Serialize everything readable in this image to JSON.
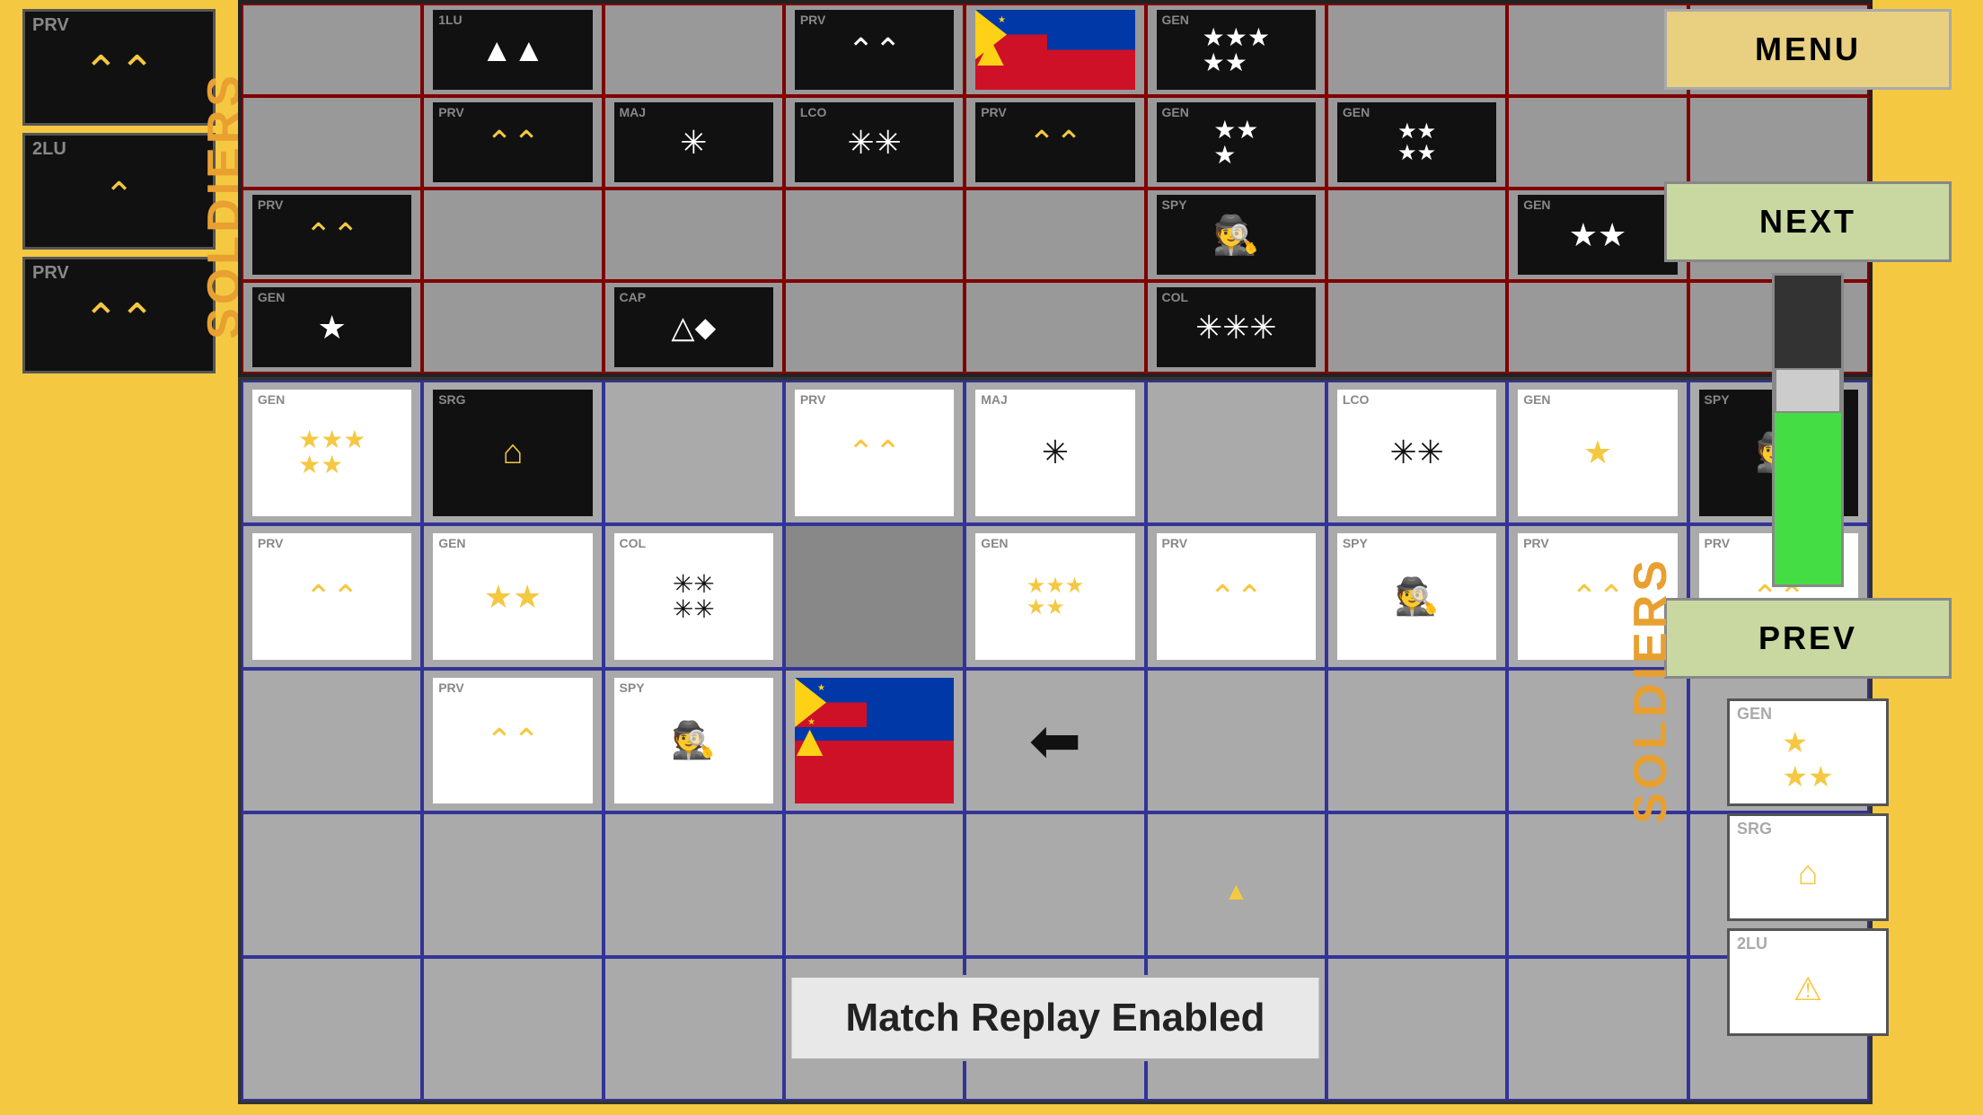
{
  "left_sidebar": {
    "cards": [
      {
        "rank": "PRV",
        "symbol": "⌃⌃",
        "type": "double_chevron"
      },
      {
        "rank": "2LU",
        "symbol": "⌃",
        "type": "single_chevron"
      },
      {
        "rank": "PRV",
        "symbol": "⌃⌃",
        "type": "double_chevron"
      }
    ],
    "soldiers_label": "SOLDIERS"
  },
  "right_sidebar": {
    "menu_label": "MENU",
    "next_label": "NEXT",
    "prev_label": "PREV",
    "soldiers_label": "SOLDIERS",
    "bottom_cards": [
      {
        "rank": "GEN",
        "symbol": "★★★",
        "stars": 3
      },
      {
        "rank": "SRG",
        "symbol": "⌂"
      },
      {
        "rank": "2LU",
        "symbol": "⚠"
      }
    ]
  },
  "match_replay": {
    "text": "Match Replay Enabled"
  },
  "top_grid": {
    "rows": 4,
    "cols": 9
  },
  "bottom_grid": {
    "rows": 5,
    "cols": 9
  }
}
